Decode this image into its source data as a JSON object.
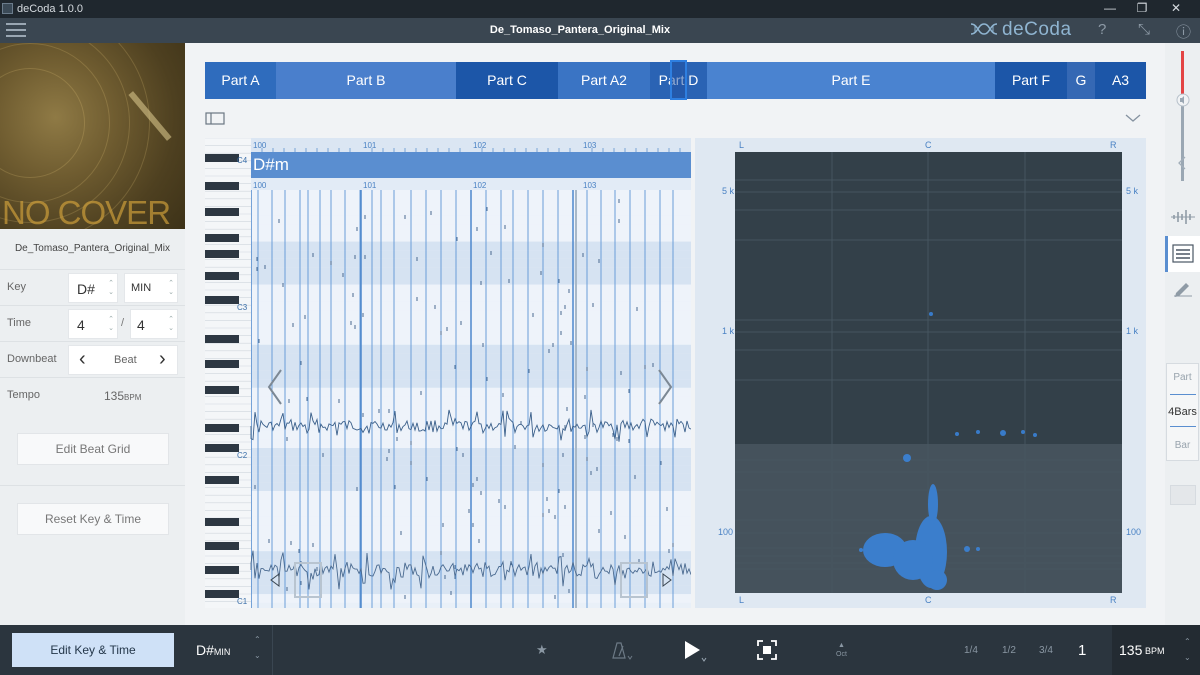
{
  "titlebar": {
    "title": "deCoda 1.0.0",
    "minimize": "—",
    "restore": "❐",
    "close": "✕"
  },
  "header": {
    "filename": "De_Tomaso_Pantera_Original_Mix",
    "logo": "deCoda",
    "help": "?",
    "expand": "⤡",
    "info": "ⓘ"
  },
  "cover": {
    "text": "NO COVER"
  },
  "track": {
    "name": "De_Tomaso_Pantera_Original_Mix"
  },
  "properties": {
    "key_label": "Key",
    "key_value": "D#",
    "mode_value": "MIN",
    "time_label": "Time",
    "time_num": "4",
    "time_sep": "/",
    "time_den": "4",
    "downbeat_label": "Downbeat",
    "downbeat_value": "Beat",
    "prev": "‹",
    "next": "›",
    "tempo_label": "Tempo",
    "tempo_value": "135",
    "tempo_unit": "BPM"
  },
  "buttons": {
    "edit_beat_grid": "Edit Beat Grid",
    "reset_key_time": "Reset Key & Time",
    "edit_key_time": "Edit Key & Time"
  },
  "parts": [
    {
      "label": "Part A",
      "color": "#2f6cbd"
    },
    {
      "label": "Part B",
      "color": "#4a7fcc"
    },
    {
      "label": "Part C",
      "color": "#1c56a8"
    },
    {
      "label": "Part A2",
      "color": "#3a74c4"
    },
    {
      "label": "Part D",
      "color": "#2a63b4"
    },
    {
      "label": "Part E",
      "color": "#4a83d0"
    },
    {
      "label": "Part F",
      "color": "#1c56a8"
    },
    {
      "label": "G",
      "color": "#3568b4"
    },
    {
      "label": "A3",
      "color": "#1c56a8"
    }
  ],
  "pianoroll": {
    "chord": "D#m",
    "bars": [
      "100",
      "101",
      "102",
      "103"
    ],
    "octaves": [
      "C4",
      "C3",
      "C2",
      "C1"
    ]
  },
  "spectrum": {
    "left": "L",
    "center": "C",
    "right": "R",
    "freq": [
      "5 k",
      "1 k",
      "100"
    ]
  },
  "right_panel": {
    "part": "Part",
    "bars": "4Bars",
    "bar": "Bar"
  },
  "bottom": {
    "key": "D#",
    "mode": "MIN",
    "octave": "Oct",
    "fractions": [
      "1/4",
      "1/2",
      "3/4"
    ],
    "beat": "1",
    "tempo": "135",
    "tempo_unit": "BPM"
  },
  "colors": {
    "accent": "#2f6cbd",
    "panel": "#eceff1",
    "dark": "#2b353e"
  }
}
